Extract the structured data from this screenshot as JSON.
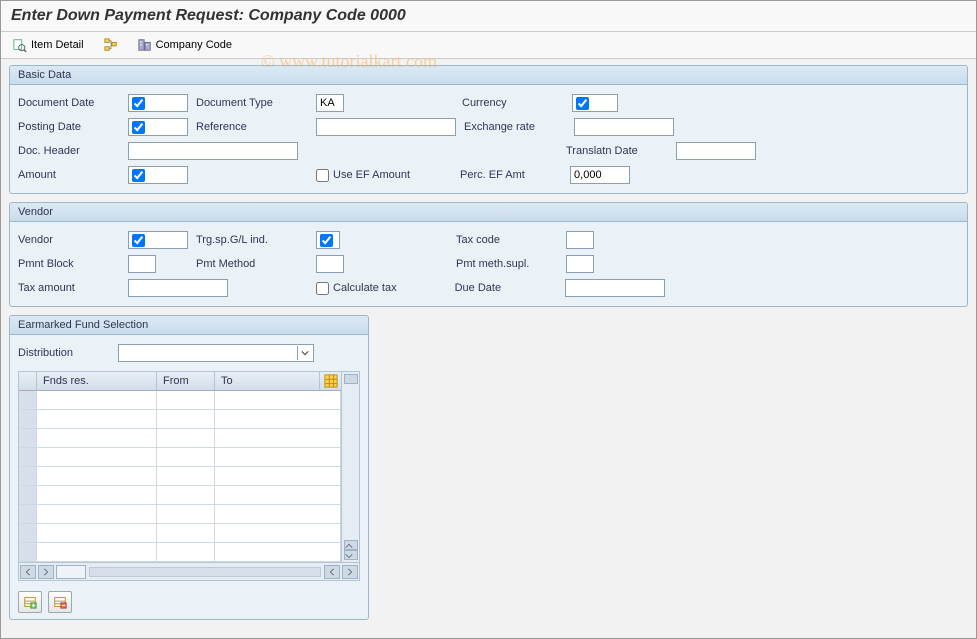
{
  "title": "Enter Down Payment Request: Company Code 0000",
  "watermark": "© www.tutorialkart.com",
  "toolbar": {
    "item_detail": "Item Detail",
    "company_code": "Company Code"
  },
  "basic": {
    "title": "Basic Data",
    "document_date_lbl": "Document Date",
    "document_type_lbl": "Document Type",
    "document_type_val": "KA",
    "currency_lbl": "Currency",
    "posting_date_lbl": "Posting Date",
    "reference_lbl": "Reference",
    "exchange_rate_lbl": "Exchange rate",
    "doc_header_lbl": "Doc. Header",
    "translatn_date_lbl": "Translatn Date",
    "amount_lbl": "Amount",
    "use_ef_lbl": "Use EF Amount",
    "perc_ef_lbl": "Perc. EF Amt",
    "perc_ef_val": "0,000"
  },
  "vendor": {
    "title": "Vendor",
    "vendor_lbl": "Vendor",
    "trg_lbl": "Trg.sp.G/L ind.",
    "tax_code_lbl": "Tax code",
    "pmnt_block_lbl": "Pmnt Block",
    "pmt_method_lbl": "Pmt Method",
    "pmt_meth_supl_lbl": "Pmt meth.supl.",
    "tax_amount_lbl": "Tax amount",
    "calc_tax_lbl": "Calculate tax",
    "due_date_lbl": "Due Date"
  },
  "ef": {
    "title": "Earmarked Fund Selection",
    "distribution_lbl": "Distribution",
    "col_fnds": "Fnds res.",
    "col_from": "From",
    "col_to": "To"
  }
}
